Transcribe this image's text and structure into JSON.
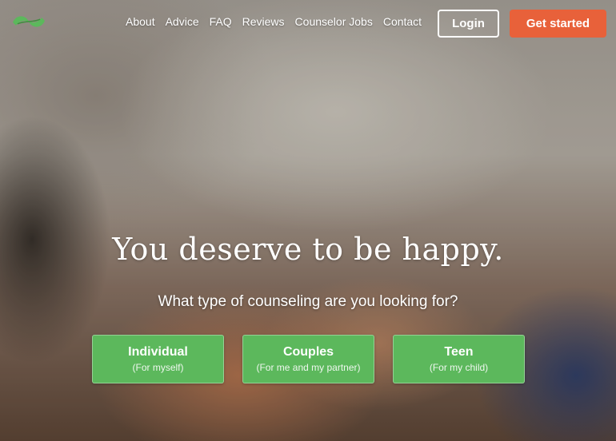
{
  "nav": {
    "items": [
      "About",
      "Advice",
      "FAQ",
      "Reviews",
      "Counselor Jobs",
      "Contact"
    ],
    "login_label": "Login",
    "cta_label": "Get started"
  },
  "brand": {
    "logo_icon": "leaf-logo-icon",
    "accent": "#5cb85c",
    "cta_color": "#e8613a"
  },
  "hero": {
    "headline": "You deserve to be happy.",
    "question": "What type of counseling are you looking for?",
    "options": [
      {
        "title": "Individual",
        "subtitle": "(For myself)"
      },
      {
        "title": "Couples",
        "subtitle": "(For me and my partner)"
      },
      {
        "title": "Teen",
        "subtitle": "(For my child)"
      }
    ]
  }
}
